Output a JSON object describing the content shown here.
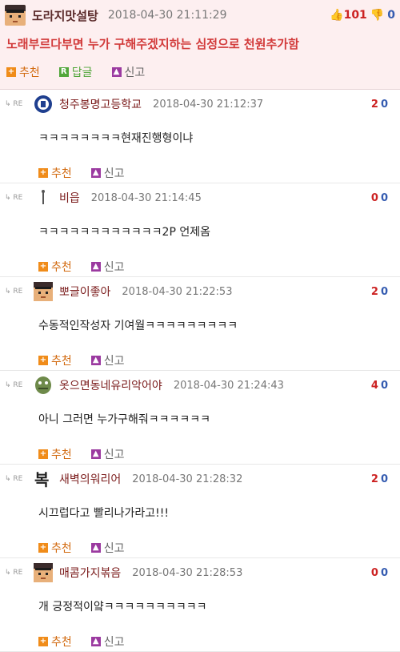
{
  "post": {
    "nick": "도라지맛설탕",
    "date": "2018-04-30 21:11:29",
    "up": "101",
    "down": "0",
    "body": "노래부르다부면 누가 구해주겠지하는 심정으로 천원추가함",
    "recommend": "추천",
    "reply": "답글",
    "report": "신고"
  },
  "comments": [
    {
      "nick": "청주봉명고등학교",
      "date": "2018-04-30 21:12:37",
      "up": "2",
      "down": "0",
      "body": "ㅋㅋㅋㅋㅋㅋㅋㅋ현재진행형이냐",
      "avatar": "school-emblem"
    },
    {
      "nick": "비읍",
      "date": "2018-04-30 21:14:45",
      "up": "0",
      "down": "0",
      "body": "ㅋㅋㅋㅋㅋㅋㅋㅋㅋㅋㅋㅋ2P 언제옴",
      "avatar": "tiny-figure"
    },
    {
      "nick": "뽀글이좋아",
      "date": "2018-04-30 21:22:53",
      "up": "2",
      "down": "0",
      "body": "수동적인작성자 기여월ㅋㅋㅋㅋㅋㅋㅋㅋㅋ",
      "avatar": "pixel-face"
    },
    {
      "nick": "옷으면동네유리악어야",
      "date": "2018-04-30 21:24:43",
      "up": "4",
      "down": "0",
      "body": "아니 그러면 누가구해줘ㅋㅋㅋㅋㅋㅋ",
      "avatar": "crocodile"
    },
    {
      "nick": "새벽의워리어",
      "date": "2018-04-30 21:28:32",
      "up": "2",
      "down": "0",
      "body": "시끄럽다고 빨리나가라고!!!",
      "avatar": "bok-char"
    },
    {
      "nick": "매콤가지볶음",
      "date": "2018-04-30 21:28:53",
      "up": "0",
      "down": "0",
      "body": "개 긍정적이얔ㅋㅋㅋㅋㅋㅋㅋㅋㅋㅋ",
      "avatar": "pixel-face"
    }
  ],
  "labels": {
    "re": "RE",
    "recommend": "추천",
    "report": "신고",
    "bok": "복"
  },
  "colors": {
    "accent_orange": "#f08c1a",
    "report_purple": "#9b3aa0",
    "up_red": "#c22222",
    "down_blue": "#345bb0"
  }
}
